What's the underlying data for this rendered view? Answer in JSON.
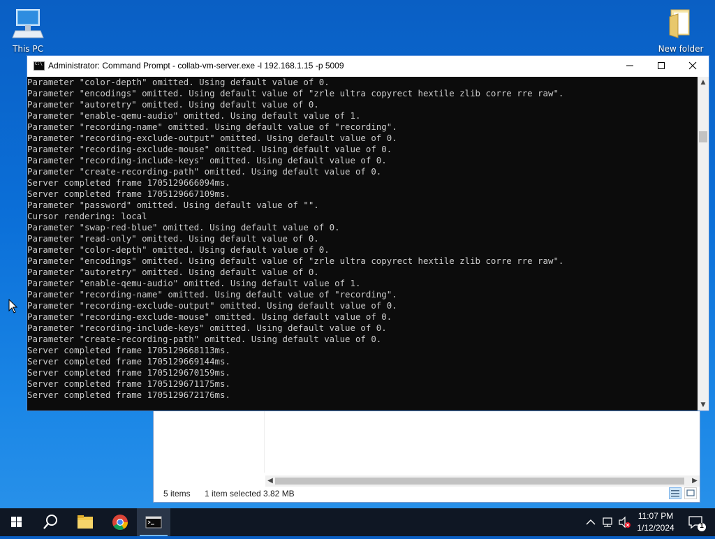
{
  "desktop": {
    "icons": [
      {
        "label": "This PC"
      },
      {
        "label": "New folder"
      }
    ]
  },
  "explorer": {
    "status_items": "5 items",
    "status_selected": "1 item selected",
    "status_size": "3.82 MB"
  },
  "cmd": {
    "title": "Administrator: Command Prompt - collab-vm-server.exe  -l 192.168.1.15 -p 5009",
    "lines": [
      "Parameter \"color-depth\" omitted. Using default value of 0.",
      "Parameter \"encodings\" omitted. Using default value of \"zrle ultra copyrect hextile zlib corre rre raw\".",
      "Parameter \"autoretry\" omitted. Using default value of 0.",
      "Parameter \"enable-qemu-audio\" omitted. Using default value of 1.",
      "Parameter \"recording-name\" omitted. Using default value of \"recording\".",
      "Parameter \"recording-exclude-output\" omitted. Using default value of 0.",
      "Parameter \"recording-exclude-mouse\" omitted. Using default value of 0.",
      "Parameter \"recording-include-keys\" omitted. Using default value of 0.",
      "Parameter \"create-recording-path\" omitted. Using default value of 0.",
      "Server completed frame 1705129666094ms.",
      "Server completed frame 1705129667109ms.",
      "Parameter \"password\" omitted. Using default value of \"\".",
      "Cursor rendering: local",
      "Parameter \"swap-red-blue\" omitted. Using default value of 0.",
      "Parameter \"read-only\" omitted. Using default value of 0.",
      "Parameter \"color-depth\" omitted. Using default value of 0.",
      "Parameter \"encodings\" omitted. Using default value of \"zrle ultra copyrect hextile zlib corre rre raw\".",
      "Parameter \"autoretry\" omitted. Using default value of 0.",
      "Parameter \"enable-qemu-audio\" omitted. Using default value of 1.",
      "Parameter \"recording-name\" omitted. Using default value of \"recording\".",
      "Parameter \"recording-exclude-output\" omitted. Using default value of 0.",
      "Parameter \"recording-exclude-mouse\" omitted. Using default value of 0.",
      "Parameter \"recording-include-keys\" omitted. Using default value of 0.",
      "Parameter \"create-recording-path\" omitted. Using default value of 0.",
      "Server completed frame 1705129668113ms.",
      "Server completed frame 1705129669144ms.",
      "Server completed frame 1705129670159ms.",
      "Server completed frame 1705129671175ms.",
      "Server completed frame 1705129672176ms."
    ]
  },
  "taskbar": {
    "apps": [
      {
        "icon": "windows-start-icon"
      },
      {
        "icon": "search-icon"
      },
      {
        "icon": "file-explorer-icon"
      },
      {
        "icon": "chrome-icon"
      },
      {
        "icon": "command-prompt-icon",
        "active": true
      }
    ],
    "time": "11:07 PM",
    "date": "1/12/2024",
    "notification_count": "1"
  },
  "colors": {
    "desktop": "#0b6fd8",
    "console_bg": "#0c0c0c",
    "console_text": "#cccccc",
    "taskbar": "#0f1724",
    "accent": "#76b9ed"
  }
}
